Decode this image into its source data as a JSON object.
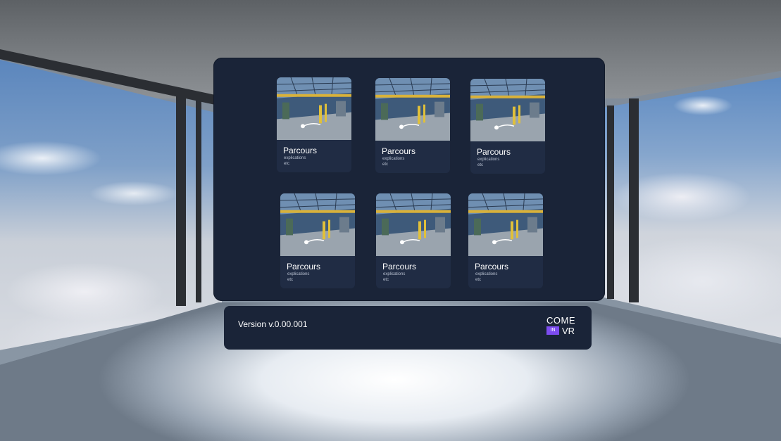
{
  "panel": {
    "cards": [
      {
        "title": "Parcours",
        "line1": "explications",
        "line2": "etc"
      },
      {
        "title": "Parcours",
        "line1": "explications",
        "line2": "etc"
      },
      {
        "title": "Parcours",
        "line1": "explications",
        "line2": "etc"
      },
      {
        "title": "Parcours",
        "line1": "explications",
        "line2": "etc"
      },
      {
        "title": "Parcours",
        "line1": "explications",
        "line2": "etc"
      },
      {
        "title": "Parcours",
        "line1": "explications",
        "line2": "etc"
      }
    ]
  },
  "footer": {
    "version": "Version v.0.00.001",
    "logo_top": "COME",
    "logo_badge": "IN",
    "logo_bottom": "VR"
  },
  "colors": {
    "panel_bg": "#1a2438",
    "card_bg": "#202c44",
    "logo_accent": "#7d4cf0"
  }
}
